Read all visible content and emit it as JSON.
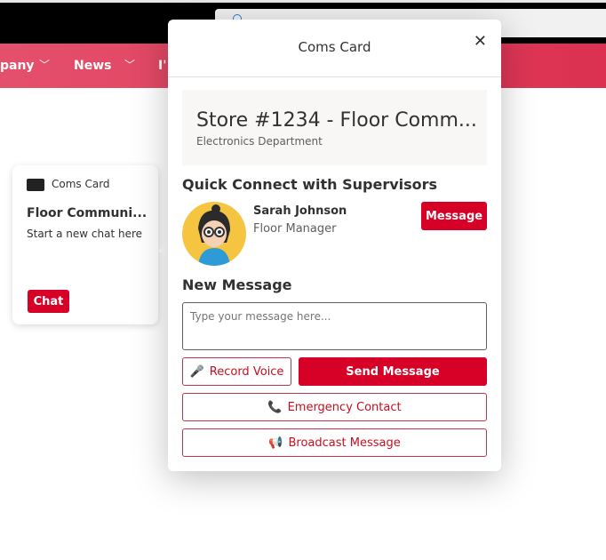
{
  "nav": {
    "items": [
      "pany",
      "News",
      "I'"
    ]
  },
  "card": {
    "label": "Coms Card",
    "title": "Floor Communi...",
    "subtitle": "Start a new chat here",
    "button": "Chat"
  },
  "dialog": {
    "title": "Coms Card",
    "close": "✕",
    "store": {
      "title": "Store #1234 - Floor Comm...",
      "department": "Electronics Department"
    },
    "quick_connect_heading": "Quick Connect with Supervisors",
    "supervisor": {
      "name": "Sarah Johnson",
      "role": "Floor Manager",
      "button": "Message"
    },
    "new_message_heading": "New Message",
    "message_placeholder": "Type your message here...",
    "record_voice": "Record Voice",
    "send_message": "Send Message",
    "emergency_contact": "Emergency Contact",
    "broadcast_message": "Broadcast Message"
  },
  "colors": {
    "brand": "#d70026",
    "nav": "#dc3150"
  }
}
